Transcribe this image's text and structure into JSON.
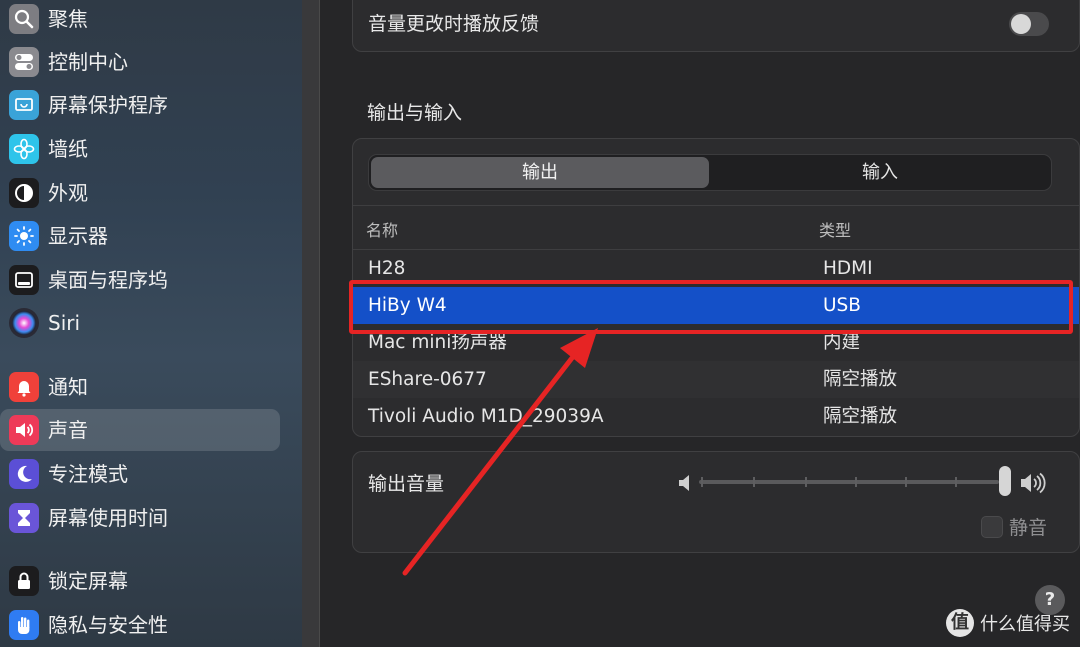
{
  "sidebar": {
    "items": [
      {
        "label": "聚焦",
        "icon": "magnifier-icon",
        "color": "#7d7d82"
      },
      {
        "label": "控制中心",
        "icon": "toggles-icon",
        "color": "#8a8a8f"
      },
      {
        "label": "屏幕保护程序",
        "icon": "screensaver-icon",
        "color": "#3aa3d8"
      },
      {
        "label": "墙纸",
        "icon": "flower-icon",
        "color": "#2ec4ea"
      },
      {
        "label": "外观",
        "icon": "appearance-icon",
        "color": "#1c1c1e"
      },
      {
        "label": "显示器",
        "icon": "sun-icon",
        "color": "#2f8cf2"
      },
      {
        "label": "桌面与程序坞",
        "icon": "dock-icon",
        "color": "#1c1c1e"
      },
      {
        "label": "Siri",
        "icon": "siri-icon",
        "color": "#2a2a35"
      },
      {
        "label": "通知",
        "icon": "bell-icon",
        "color": "#f0413a"
      },
      {
        "label": "声音",
        "icon": "speaker-icon",
        "color": "#ee3a58"
      },
      {
        "label": "专注模式",
        "icon": "moon-icon",
        "color": "#5b4fd6"
      },
      {
        "label": "屏幕使用时间",
        "icon": "hourglass-icon",
        "color": "#6a55d8"
      },
      {
        "label": "锁定屏幕",
        "icon": "lock-icon",
        "color": "#1c1c1e"
      },
      {
        "label": "隐私与安全性",
        "icon": "hand-icon",
        "color": "#2f7cf2"
      }
    ],
    "active_index": 9
  },
  "main": {
    "feedback_label": "音量更改时播放反馈",
    "feedback_on": false,
    "section_title": "输出与输入",
    "tabs": [
      {
        "label": "输出",
        "selected": true
      },
      {
        "label": "输入",
        "selected": false
      }
    ],
    "table": {
      "headers": [
        "名称",
        "类型"
      ],
      "rows": [
        {
          "name": "H28",
          "type": "HDMI"
        },
        {
          "name": "HiBy W4",
          "type": "USB",
          "selected": true
        },
        {
          "name": "Mac mini扬声器",
          "type": "内建"
        },
        {
          "name": "EShare-0677",
          "type": "隔空播放"
        },
        {
          "name": "Tivoli Audio M1D_29039A",
          "type": "隔空播放"
        }
      ]
    },
    "volume_label": "输出音量",
    "volume_level": 1.0,
    "mute_label": "静音",
    "mute_checked": false,
    "help_label": "?"
  },
  "annotation": {
    "highlight_color": "#e62424"
  },
  "watermark": {
    "logo": "值",
    "text": "什么值得买"
  }
}
